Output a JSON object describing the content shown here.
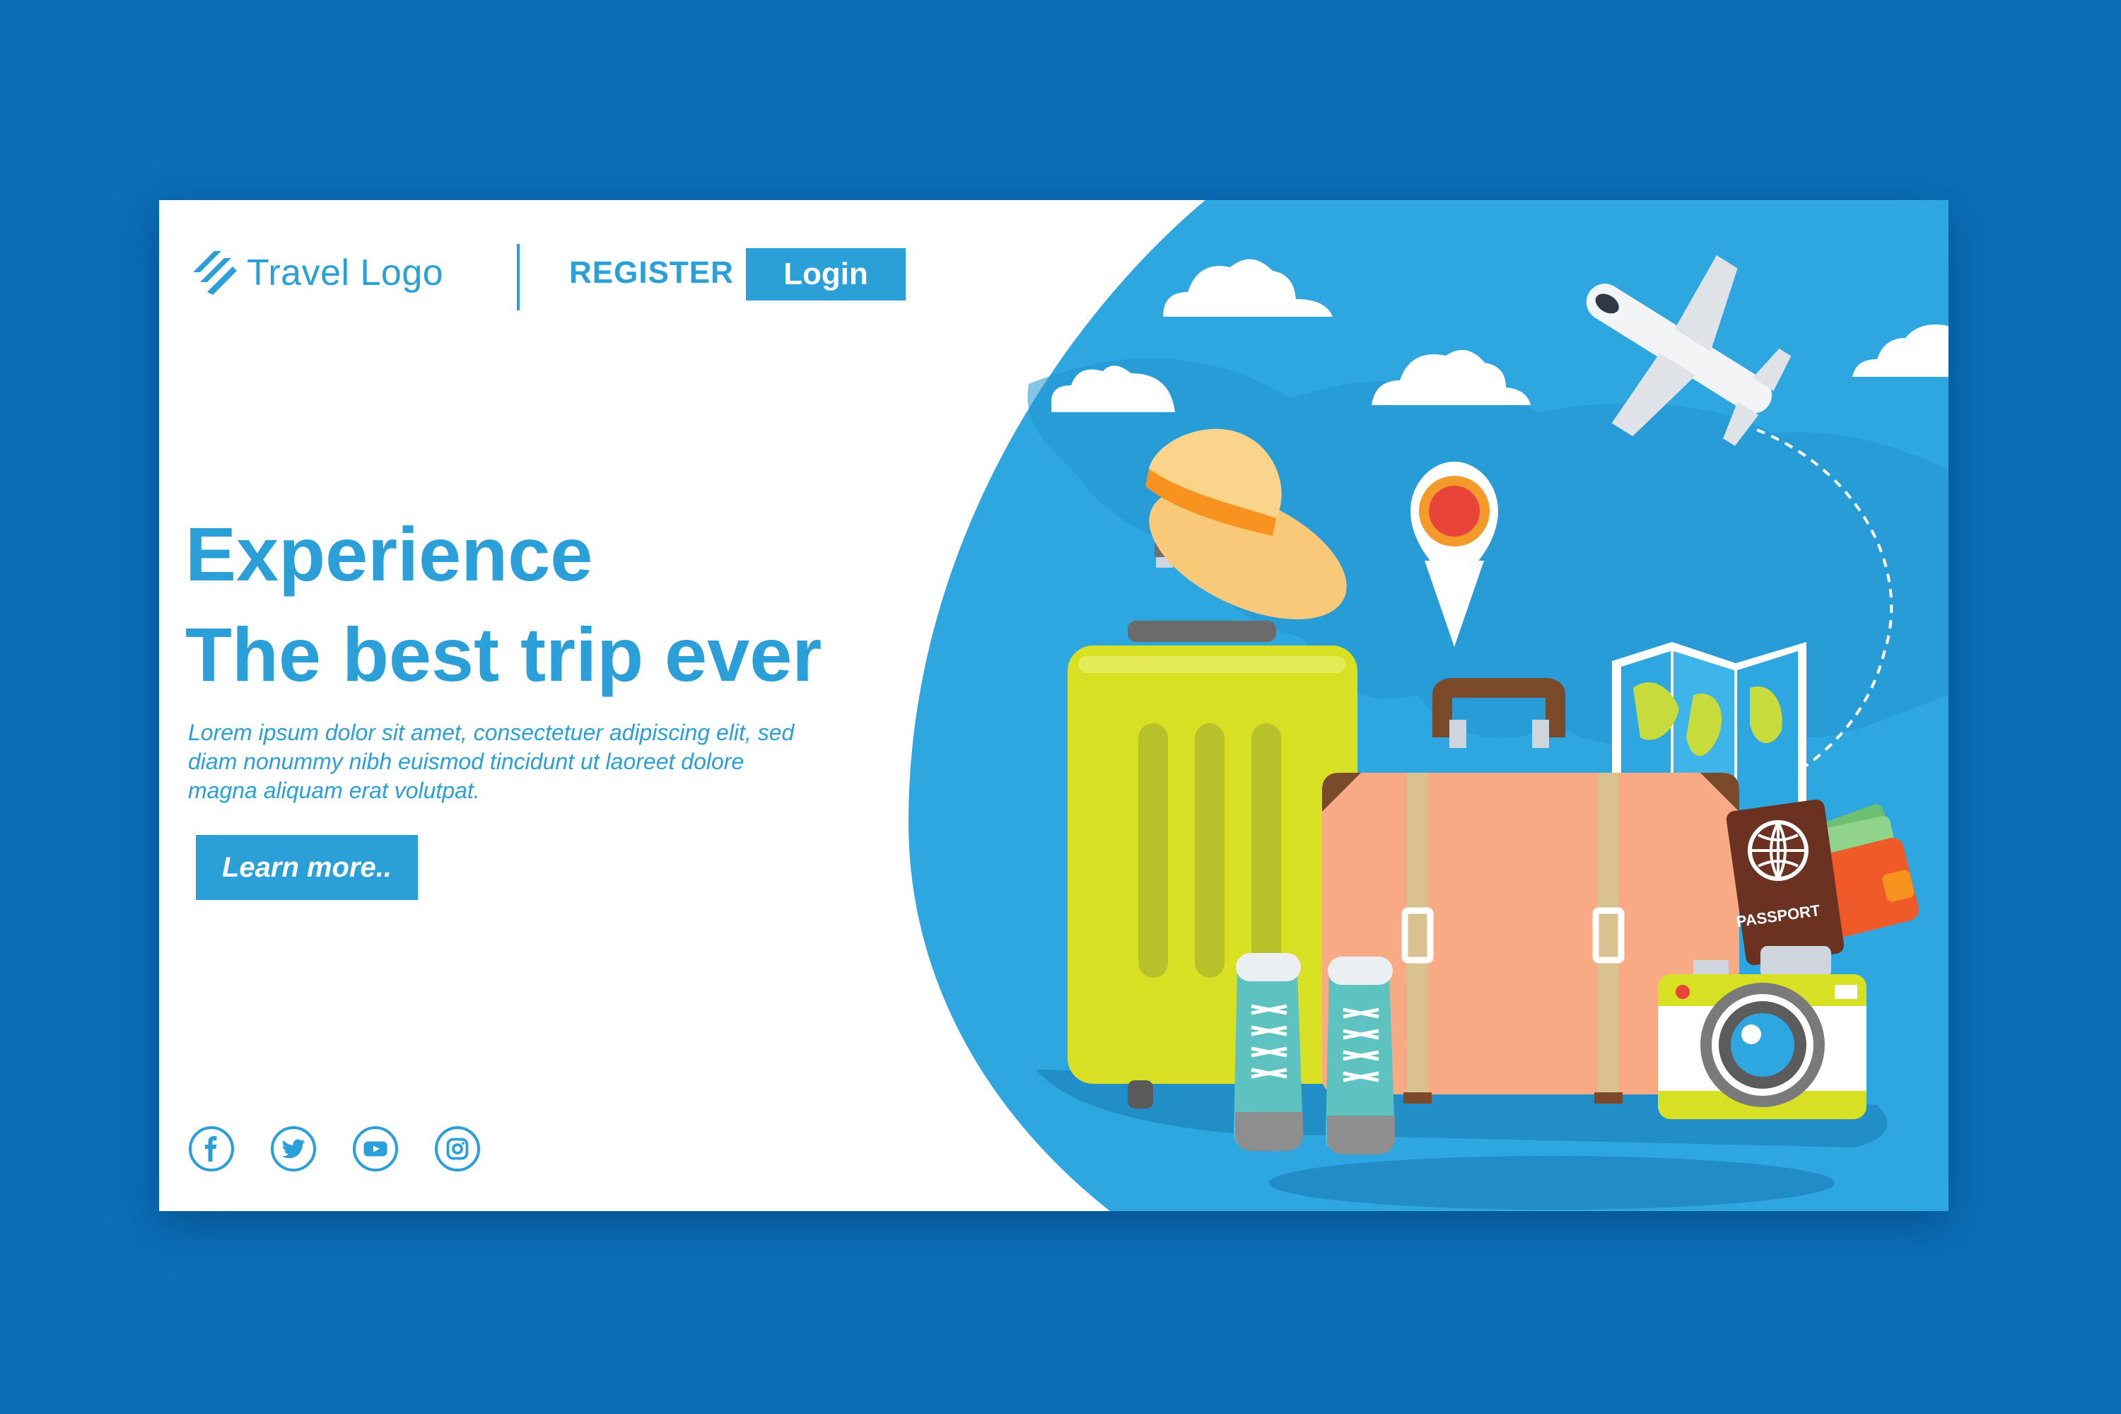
{
  "header": {
    "logo_text": "Travel Logo",
    "register_label": "REGISTER",
    "login_label": "Login"
  },
  "hero": {
    "headline_line1": "Experience",
    "headline_line2": "The best trip ever",
    "body": "Lorem ipsum dolor sit amet, consectetuer adipiscing elit, sed diam nonummy nibh euismod tincidunt ut laoreet dolore magna aliquam erat volutpat.",
    "cta_label": "Learn more.."
  },
  "illustration": {
    "passport_label": "PASSPORT"
  },
  "socials": [
    {
      "icon": "facebook-icon"
    },
    {
      "icon": "twitter-icon"
    },
    {
      "icon": "youtube-icon"
    },
    {
      "icon": "instagram-icon"
    }
  ],
  "colors": {
    "page_background": "#0a6fb7",
    "accent": "#2a9fd8",
    "card": "#ffffff"
  }
}
